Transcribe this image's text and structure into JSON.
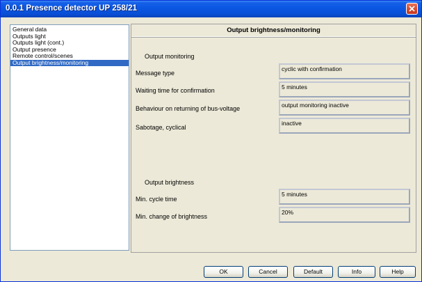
{
  "window": {
    "title": "0.0.1 Presence detector UP 258/21"
  },
  "nav": {
    "items": [
      {
        "label": "General data",
        "selected": false
      },
      {
        "label": "Outputs light",
        "selected": false
      },
      {
        "label": "Outputs light (cont.)",
        "selected": false
      },
      {
        "label": "Output presence",
        "selected": false
      },
      {
        "label": "Remote control/scenes",
        "selected": false
      },
      {
        "label": "Output brightness/monitoring",
        "selected": true
      }
    ]
  },
  "panel": {
    "title": "Output brightness/monitoring",
    "monitoring": {
      "heading": "Output monitoring",
      "rows": [
        {
          "label": "Message type",
          "value": "cyclic with confirmation"
        },
        {
          "label": "Waiting time for confirmation",
          "value": "5 minutes"
        },
        {
          "label": "Behaviour on returning of bus-voltage",
          "value": "output monitoring inactive"
        },
        {
          "label": "Sabotage, cyclical",
          "value": "inactive"
        }
      ]
    },
    "brightness": {
      "heading": "Output brightness",
      "rows": [
        {
          "label": "Min. cycle time",
          "value": "5 minutes"
        },
        {
          "label": "Min. change of brightness",
          "value": "20%"
        }
      ]
    }
  },
  "buttons": {
    "ok": "OK",
    "cancel": "Cancel",
    "default": "Default",
    "info": "Info",
    "help": "Help"
  },
  "colors": {
    "titlebar": "#0a55e0",
    "selection": "#316ac5",
    "dialog_bg": "#ece9d8",
    "close_button": "#d4472b"
  }
}
